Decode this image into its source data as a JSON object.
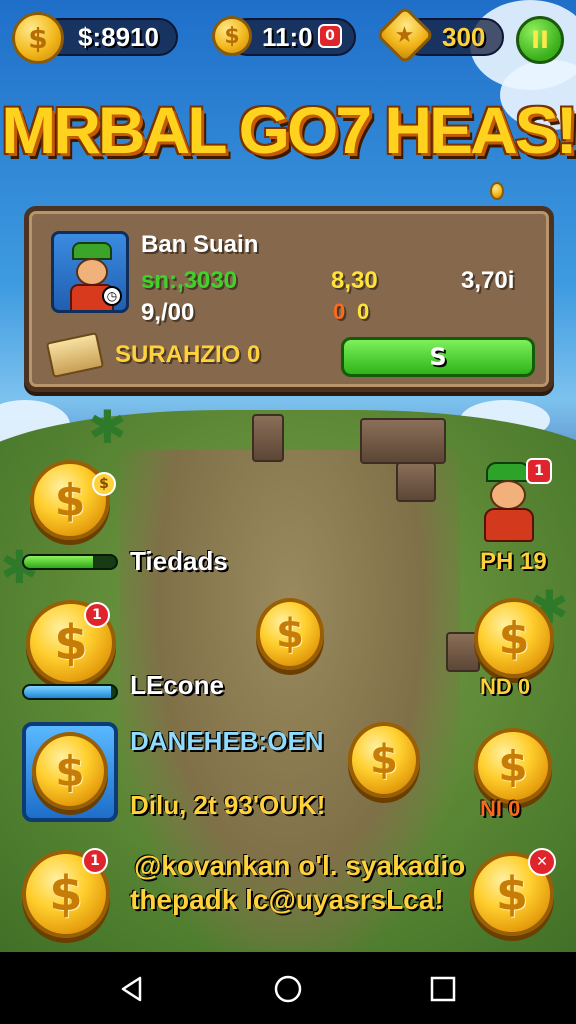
{
  "hud": {
    "money": "$:8910",
    "timer": "11:0",
    "timer_badge": "0",
    "stars": "300",
    "pause_label": "II"
  },
  "title": "MRBAL GO7 HEAS!",
  "panel": {
    "name": "Ban Suain",
    "stat1": "sn:,3030",
    "stat2": "8,30",
    "stat3": "3,70i",
    "stat4": "9,/00",
    "stat5": "0",
    "stat6": "0",
    "resource_label": "SURAHZIO 0",
    "action_button": "S"
  },
  "left_items": {
    "item1_label": "Tiedads",
    "item1_progress": 0.75,
    "item2_label": "LEcone",
    "item2_progress": 0.95,
    "item3_title": "DANEHEB:OEN",
    "item3_sub": "Dilu, 2t 93'OUK!"
  },
  "right_items": {
    "char_label": "PH 19",
    "coin1_label": "ND 0",
    "coin2_label": "NI 0"
  },
  "footer_text": {
    "line1": "@kovankan o'l. syakadio",
    "line2": "thepadk lc@uyasrsLca!"
  },
  "badges": {
    "char_badge": "1",
    "coin_badge": "1",
    "bottom_badge": "1"
  },
  "coin_glyph": "$",
  "colors": {
    "gold": "#ffd23c",
    "green": "#3fd22a",
    "panel": "#86684c"
  }
}
